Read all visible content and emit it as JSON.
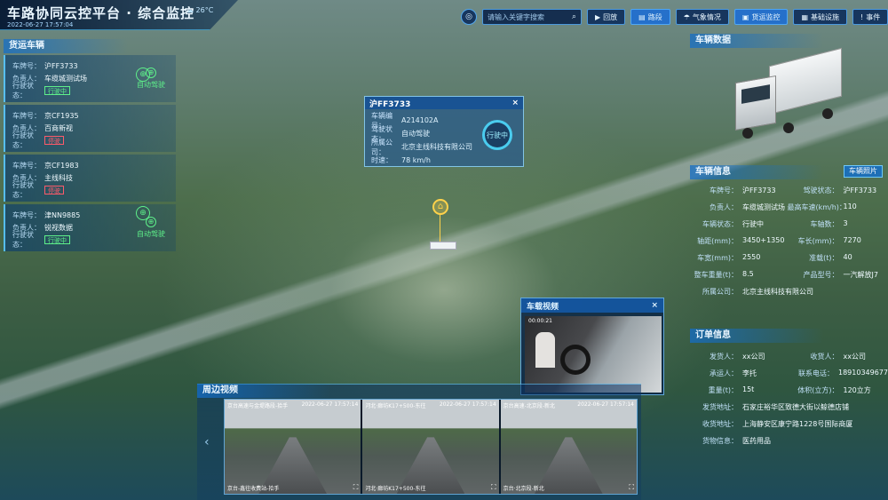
{
  "header": {
    "title": "车路协同云控平台 · 综合监控",
    "datetime": "2022-06-27 17:57:04",
    "weather": "26°C"
  },
  "toolbar": {
    "search_placeholder": "请输入关键字搜索",
    "buttons": [
      {
        "label": "回放",
        "active": false
      },
      {
        "label": "路段",
        "active": true
      },
      {
        "label": "气象情况",
        "active": false
      },
      {
        "label": "货运监控",
        "active": true
      },
      {
        "label": "基础设施",
        "active": false
      },
      {
        "label": "事件",
        "active": false
      }
    ]
  },
  "freight_vehicles": {
    "title": "货运车辆",
    "labels": {
      "plate": "车牌号：",
      "owner": "负责人：",
      "status": "行驶状态："
    },
    "auto_label": "自动驾驶",
    "items": [
      {
        "plate": "沪FF3733",
        "owner": "车缆城测试场",
        "status": "行驶中",
        "state": "on",
        "auto": true
      },
      {
        "plate": "京CF1935",
        "owner": "百商新视",
        "status": "停驶",
        "state": "off",
        "auto": false
      },
      {
        "plate": "京CF1983",
        "owner": "主线科技",
        "status": "停驶",
        "state": "off",
        "auto": false
      },
      {
        "plate": "津NN9885",
        "owner": "锐视数据",
        "status": "行驶中",
        "state": "on",
        "auto": true
      }
    ]
  },
  "popup": {
    "plate": "沪FF3733",
    "close": "×",
    "rows": [
      {
        "k": "车辆编号：",
        "v": "A214102A"
      },
      {
        "k": "驾驶状态：",
        "v": "自动驾驶"
      },
      {
        "k": "所属公司：",
        "v": "北京主线科技有限公司"
      },
      {
        "k": "时速：",
        "v": "78 km/h"
      }
    ],
    "gauge": "行驶中"
  },
  "vehicle_detail": {
    "title": "车辆数据",
    "info_title": "车辆信息",
    "tag": "车辆照片",
    "rows": [
      [
        {
          "k": "车牌号：",
          "v": "沪FF3733"
        },
        {
          "k": "驾驶状态：",
          "v": "沪FF3733"
        }
      ],
      [
        {
          "k": "负责人：",
          "v": "车缆城测试场"
        },
        {
          "k": "最高车速(km/h)：",
          "v": "110"
        }
      ],
      [
        {
          "k": "车辆状态：",
          "v": "行驶中"
        },
        {
          "k": "车轴数：",
          "v": "3"
        }
      ],
      [
        {
          "k": "轴距(mm)：",
          "v": "3450+1350"
        },
        {
          "k": "车长(mm)：",
          "v": "7270"
        }
      ],
      [
        {
          "k": "车宽(mm)：",
          "v": "2550"
        },
        {
          "k": "准载(t)：",
          "v": "40"
        }
      ],
      [
        {
          "k": "整车重量(t)：",
          "v": "8.5"
        },
        {
          "k": "产品型号：",
          "v": "一汽解放J7"
        }
      ],
      [
        {
          "k": "所属公司：",
          "v": "北京主线科技有限公司"
        }
      ]
    ]
  },
  "order": {
    "title": "订单信息",
    "rows": [
      [
        {
          "k": "发货人：",
          "v": "xx公司"
        },
        {
          "k": "收货人：",
          "v": "xx公司"
        }
      ],
      [
        {
          "k": "承运人：",
          "v": "李托"
        },
        {
          "k": "联系电话：",
          "v": "18910349677"
        }
      ],
      [
        {
          "k": "重量(t)：",
          "v": "15t"
        },
        {
          "k": "体积(立方)：",
          "v": "120立方"
        }
      ],
      [
        {
          "k": "发货地址：",
          "v": "石家庄裕华区致德大街以鲸德店铺"
        }
      ],
      [
        {
          "k": "收货地址：",
          "v": "上海静安区康宁路1228号国际商厦"
        }
      ],
      [
        {
          "k": "货物信息：",
          "v": "医药用品"
        }
      ]
    ]
  },
  "cabin_video": {
    "title": "车载视频",
    "close": "×",
    "timestamp": "00:00:21"
  },
  "surround_video": {
    "title": "周边视频",
    "feeds": [
      {
        "name": "京台高速与金堤路段-拾手",
        "time": "2022-06-27 17:57:14",
        "caption": "京台-鑫往收费站-拾手"
      },
      {
        "name": "河北·廊坊K17+500-东往",
        "time": "2022-06-27 17:57:14",
        "caption": "河北·廊坊K17+500-东往"
      },
      {
        "name": "京台高速-北京段-新北",
        "time": "2022-06-27 17:57:14",
        "caption": "京台·北京段-新北"
      }
    ]
  }
}
